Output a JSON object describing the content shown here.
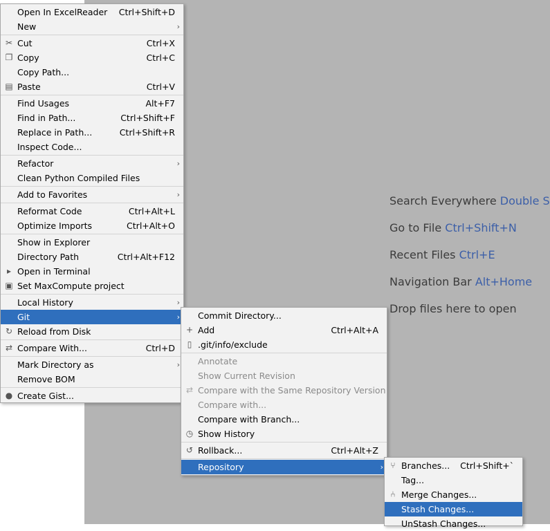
{
  "editor": {
    "hints": [
      {
        "text": "Search Everywhere ",
        "key": "Double Shift"
      },
      {
        "text": "Go to File ",
        "key": "Ctrl+Shift+N"
      },
      {
        "text": "Recent Files ",
        "key": "Ctrl+E"
      },
      {
        "text": "Navigation Bar ",
        "key": "Alt+Home"
      },
      {
        "text": "Drop files here to open",
        "key": ""
      }
    ]
  },
  "main_menu": [
    {
      "label": "Open In ExcelReader",
      "shortcut": "Ctrl+Shift+D"
    },
    {
      "label": "New",
      "submenu": true
    },
    {
      "label": "Cut",
      "shortcut": "Ctrl+X",
      "icon": "scissors-icon"
    },
    {
      "label": "Copy",
      "shortcut": "Ctrl+C",
      "icon": "copy-icon"
    },
    {
      "label": "Copy Path..."
    },
    {
      "label": "Paste",
      "shortcut": "Ctrl+V",
      "icon": "paste-icon"
    },
    {
      "label": "Find Usages",
      "shortcut": "Alt+F7"
    },
    {
      "label": "Find in Path...",
      "shortcut": "Ctrl+Shift+F"
    },
    {
      "label": "Replace in Path...",
      "shortcut": "Ctrl+Shift+R"
    },
    {
      "label": "Inspect Code..."
    },
    {
      "label": "Refactor",
      "submenu": true
    },
    {
      "label": "Clean Python Compiled Files"
    },
    {
      "label": "Add to Favorites",
      "submenu": true
    },
    {
      "label": "Reformat Code",
      "shortcut": "Ctrl+Alt+L"
    },
    {
      "label": "Optimize Imports",
      "shortcut": "Ctrl+Alt+O"
    },
    {
      "label": "Show in Explorer"
    },
    {
      "label": "Directory Path",
      "shortcut": "Ctrl+Alt+F12"
    },
    {
      "label": "Open in Terminal",
      "icon": "terminal-icon"
    },
    {
      "label": "Set MaxCompute project",
      "icon": "maxcompute-icon"
    },
    {
      "label": "Local History",
      "submenu": true
    },
    {
      "label": "Git",
      "submenu": true,
      "selected": true
    },
    {
      "label": "Reload from Disk",
      "icon": "reload-icon"
    },
    {
      "label": "Compare With...",
      "shortcut": "Ctrl+D",
      "icon": "compare-icon"
    },
    {
      "label": "Mark Directory as",
      "submenu": true
    },
    {
      "label": "Remove BOM"
    },
    {
      "label": "Create Gist...",
      "icon": "github-icon"
    }
  ],
  "git_menu": [
    {
      "label": "Commit Directory..."
    },
    {
      "label": "Add",
      "shortcut": "Ctrl+Alt+A",
      "icon": "plus-icon"
    },
    {
      "label": ".git/info/exclude",
      "icon": "file-icon"
    },
    {
      "label": "Annotate",
      "disabled": true
    },
    {
      "label": "Show Current Revision",
      "disabled": true
    },
    {
      "label": "Compare with the Same Repository Version",
      "disabled": true,
      "icon": "compare-icon"
    },
    {
      "label": "Compare with...",
      "disabled": true
    },
    {
      "label": "Compare with Branch..."
    },
    {
      "label": "Show History",
      "icon": "clock-icon"
    },
    {
      "label": "Rollback...",
      "shortcut": "Ctrl+Alt+Z",
      "icon": "rollback-icon"
    },
    {
      "label": "Repository",
      "submenu": true,
      "selected": true
    }
  ],
  "repo_menu": [
    {
      "label": "Branches...",
      "shortcut": "Ctrl+Shift+`",
      "icon": "branch-icon"
    },
    {
      "label": "Tag..."
    },
    {
      "label": "Merge Changes...",
      "icon": "merge-icon"
    },
    {
      "label": "Stash Changes...",
      "selected": true
    },
    {
      "label": "UnStash Changes..."
    }
  ],
  "icons": {
    "scissors-icon": "✂",
    "copy-icon": "❐",
    "paste-icon": "▤",
    "terminal-icon": "▸",
    "maxcompute-icon": "▣",
    "reload-icon": "↻",
    "compare-icon": "⇄",
    "github-icon": "●",
    "plus-icon": "+",
    "file-icon": "▯",
    "clock-icon": "◷",
    "rollback-icon": "↺",
    "branch-icon": "⑂",
    "merge-icon": "⑃"
  },
  "colors": {
    "selection": "#2f6fbd",
    "hint_key": "#3c5fa8",
    "editor_bg": "#b4b4b4"
  }
}
